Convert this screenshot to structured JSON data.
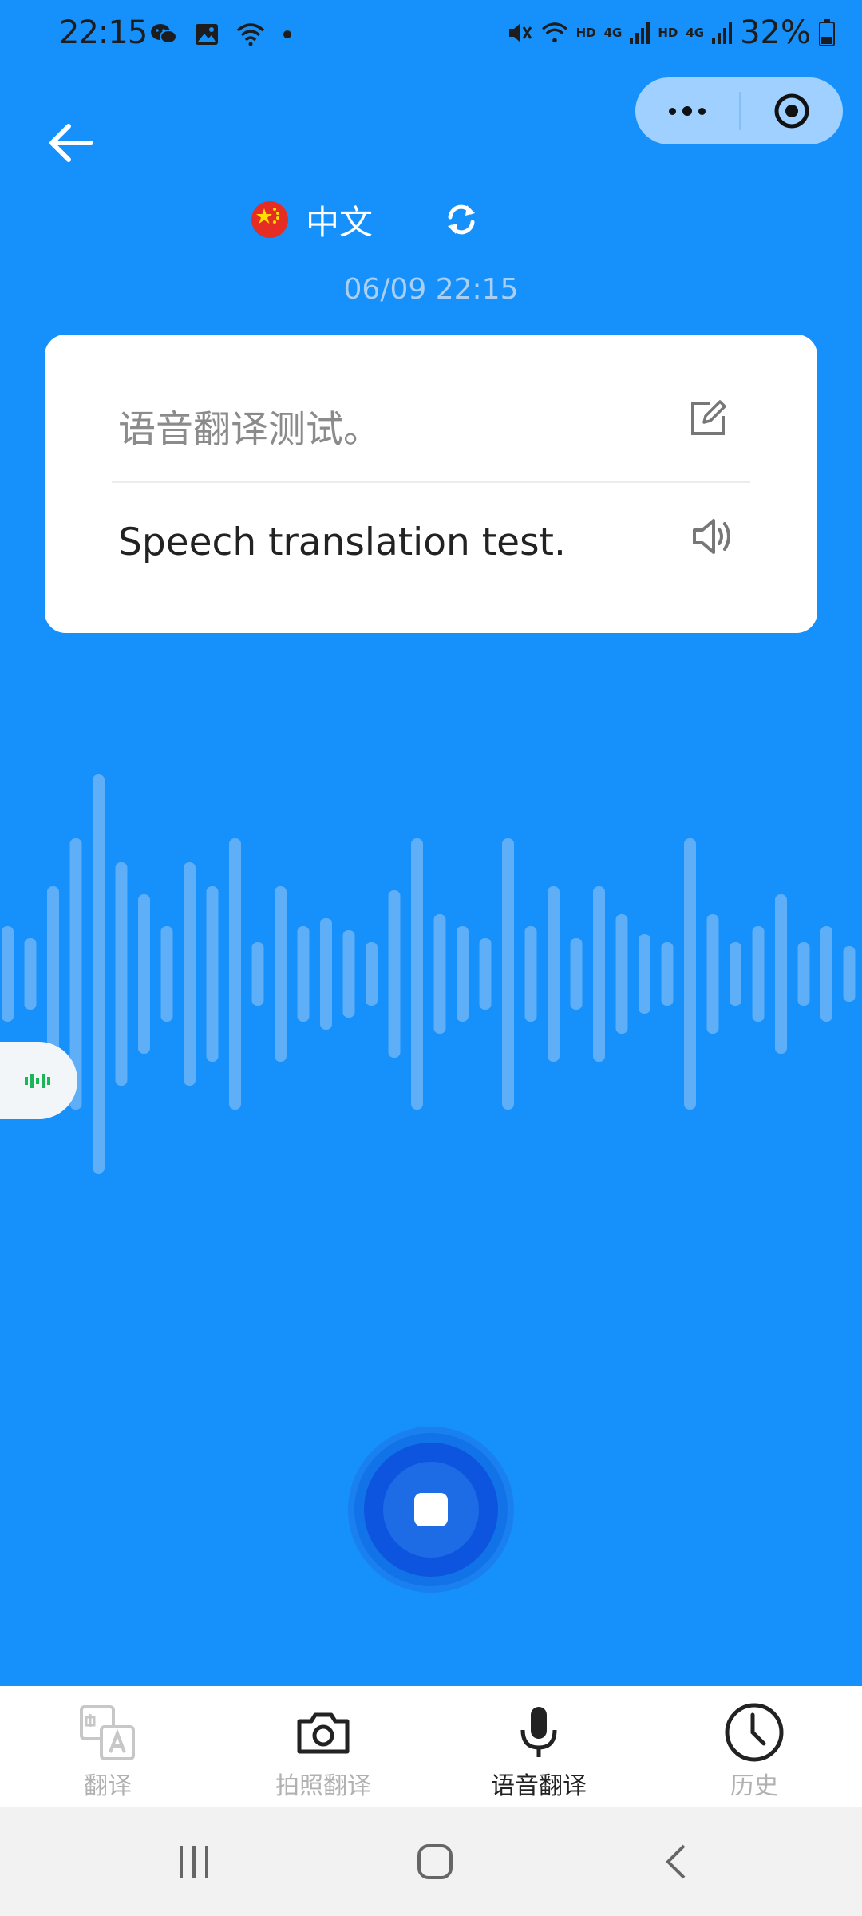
{
  "status": {
    "time": "22:15",
    "net_tag_1": "HD",
    "net_tag_2": "4G",
    "net_tag_3": "HD",
    "net_tag_4": "4G",
    "battery": "32%"
  },
  "header": {
    "language": "中文",
    "timestamp": "06/09 22:15"
  },
  "card": {
    "source_text": "语音翻译测试。",
    "target_text": "Speech translation test."
  },
  "tabs": [
    {
      "label": "翻译",
      "icon": "translate-icon"
    },
    {
      "label": "拍照翻译",
      "icon": "camera-icon"
    },
    {
      "label": "语音翻译",
      "icon": "microphone-icon"
    },
    {
      "label": "历史",
      "icon": "clock-icon"
    }
  ],
  "colors": {
    "background": "#1690fa",
    "record_button": "#0d55df",
    "active_tab": "#222222",
    "inactive_tab": "#b1b1b1"
  }
}
